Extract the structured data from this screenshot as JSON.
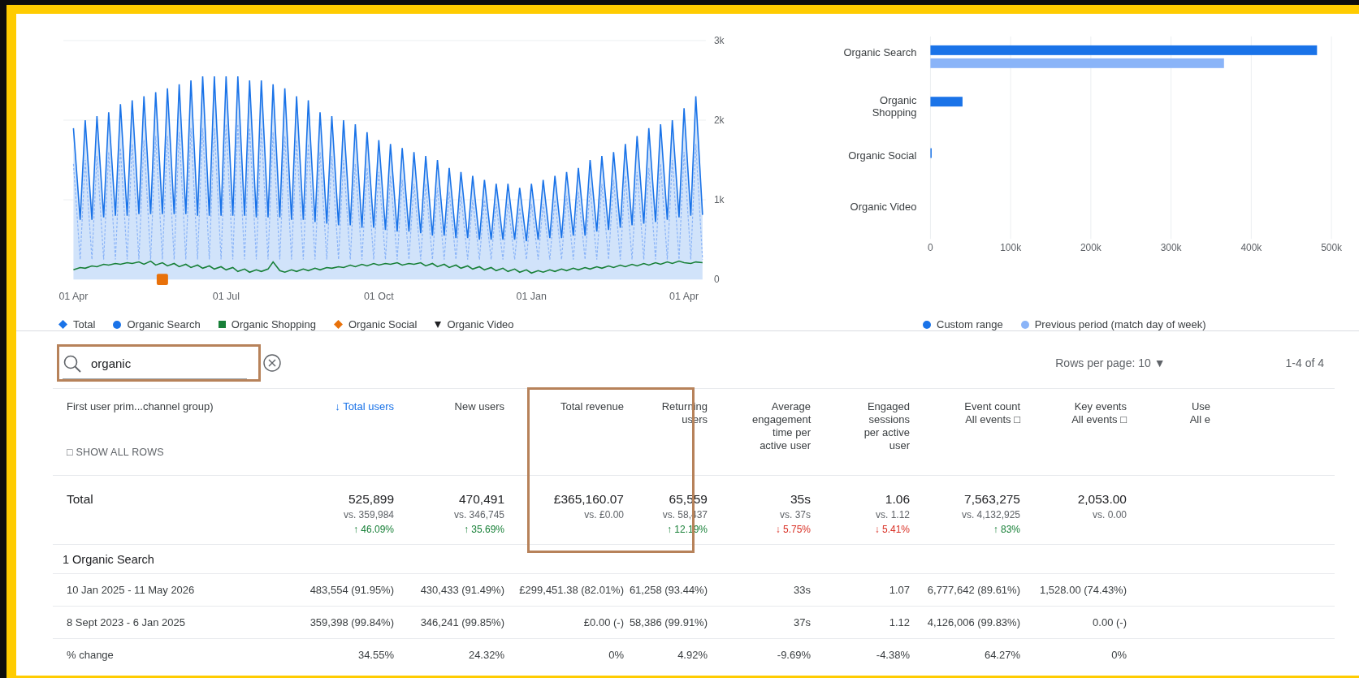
{
  "line_chart": {
    "chart_data": {
      "type": "line",
      "grid": true,
      "ylim": [
        0,
        3000
      ],
      "yticks": [
        {
          "value": 0,
          "label": "0"
        },
        {
          "value": 1000,
          "label": "1k"
        },
        {
          "value": 2000,
          "label": "2k"
        },
        {
          "value": 3000,
          "label": "3k"
        }
      ],
      "categories": [
        "01 Apr",
        null,
        null,
        null,
        null,
        null,
        null,
        null,
        null,
        null,
        null,
        null,
        null,
        null,
        null,
        null,
        null,
        null,
        null,
        null,
        null,
        null,
        null,
        null,
        null,
        null,
        "01 Jul",
        null,
        null,
        null,
        null,
        null,
        null,
        null,
        null,
        null,
        null,
        null,
        null,
        null,
        null,
        null,
        null,
        null,
        null,
        null,
        null,
        null,
        null,
        null,
        null,
        null,
        "01 Oct",
        null,
        null,
        null,
        null,
        null,
        null,
        null,
        null,
        null,
        null,
        null,
        null,
        null,
        null,
        null,
        null,
        null,
        null,
        null,
        null,
        null,
        null,
        null,
        null,
        null,
        "01 Jan",
        null,
        null,
        null,
        null,
        null,
        null,
        null,
        null,
        null,
        null,
        null,
        null,
        null,
        null,
        null,
        null,
        null,
        null,
        null,
        null,
        null,
        null,
        null,
        null,
        null,
        "01 Apr",
        null,
        null,
        null
      ],
      "series": [
        {
          "color": "#1a73e8",
          "type": "area",
          "values": [
            1900,
            750,
            2000,
            750,
            2050,
            780,
            2100,
            800,
            2200,
            800,
            2250,
            820,
            2300,
            820,
            2350,
            820,
            2400,
            820,
            2450,
            820,
            2500,
            800,
            2550,
            800,
            2550,
            800,
            2550,
            800,
            2550,
            800,
            2500,
            780,
            2500,
            780,
            2450,
            780,
            2400,
            750,
            2300,
            750,
            2250,
            720,
            2100,
            700,
            2050,
            680,
            2000,
            680,
            1950,
            650,
            1850,
            650,
            1750,
            620,
            1700,
            600,
            1650,
            600,
            1600,
            580,
            1550,
            550,
            1500,
            550,
            1400,
            520,
            1350,
            520,
            1300,
            500,
            1250,
            500,
            1200,
            500,
            1200,
            500,
            1150,
            480,
            1200,
            500,
            1250,
            520,
            1300,
            520,
            1350,
            550,
            1400,
            550,
            1500,
            600,
            1550,
            620,
            1600,
            650,
            1700,
            680,
            1800,
            700,
            1900,
            720,
            1950,
            750,
            2000,
            780,
            2150,
            800,
            2300,
            810
          ]
        },
        {
          "color": "#188038",
          "values": [
            120,
            150,
            140,
            170,
            160,
            190,
            180,
            200,
            190,
            210,
            200,
            220,
            190,
            230,
            180,
            210,
            170,
            200,
            160,
            190,
            150,
            180,
            140,
            170,
            130,
            160,
            120,
            150,
            100,
            130,
            90,
            120,
            100,
            130,
            220,
            110,
            90,
            120,
            100,
            130,
            110,
            140,
            120,
            150,
            140,
            160,
            150,
            180,
            160,
            190,
            170,
            200,
            180,
            200,
            190,
            210,
            180,
            200,
            190,
            210,
            170,
            200,
            160,
            190,
            150,
            180,
            140,
            170,
            130,
            160,
            120,
            150,
            110,
            140,
            100,
            130,
            90,
            120,
            80,
            110,
            90,
            120,
            100,
            130,
            110,
            140,
            120,
            150,
            130,
            160,
            140,
            170,
            150,
            180,
            160,
            190,
            170,
            200,
            180,
            210,
            190,
            220,
            200,
            230,
            210,
            200,
            220,
            210
          ]
        },
        {
          "color": "#8ab4f8",
          "line_style": "dashed",
          "values": [
            1450,
            250,
            1500,
            250,
            1550,
            250,
            1600,
            250,
            1650,
            250,
            1700,
            250,
            1750,
            250,
            1800,
            250,
            1800,
            250,
            1850,
            250,
            1900,
            250,
            1900,
            250,
            1900,
            250,
            1950,
            250,
            1950,
            250,
            1900,
            250,
            1900,
            250,
            1850,
            250,
            1800,
            250,
            1750,
            250,
            1700,
            250,
            1600,
            250,
            1550,
            250,
            1500,
            250,
            1450,
            250,
            1400,
            250,
            1350,
            250,
            1300,
            250,
            1250,
            250,
            1200,
            250,
            1200,
            250,
            1150,
            250,
            1100,
            250,
            1050,
            250,
            1000,
            250,
            1000,
            250,
            950,
            250,
            950,
            250,
            900,
            250,
            950,
            250,
            950,
            250,
            1000,
            250,
            1050,
            250,
            1100,
            250,
            1150,
            250,
            1200,
            250,
            1250,
            250,
            1300,
            250,
            1350,
            250,
            1400,
            250,
            1450,
            250,
            1500,
            250,
            1600,
            250,
            1700,
            250
          ]
        },
        {
          "color": "#e8710a",
          "marker": "square",
          "values": [
            null,
            null,
            null,
            null,
            null,
            null,
            null,
            null,
            null,
            null,
            null,
            null,
            null,
            null,
            null,
            0,
            null,
            null,
            null,
            null,
            null,
            null,
            null,
            null,
            null,
            null,
            null,
            null,
            null,
            null,
            null,
            null,
            null,
            null,
            null,
            null,
            null,
            null,
            null,
            null,
            null,
            null,
            null,
            null,
            null,
            null,
            null,
            null,
            null,
            null,
            null,
            null,
            null,
            null,
            null,
            null,
            null,
            null,
            null,
            null,
            null,
            null,
            null,
            null,
            null,
            null,
            null,
            null,
            null,
            null,
            null,
            null,
            null,
            null,
            null,
            null,
            null,
            null,
            null,
            null,
            null,
            null,
            null,
            null,
            null,
            null,
            null,
            null,
            null,
            null,
            null,
            null,
            null,
            null,
            null,
            null,
            null,
            null,
            null,
            null,
            null,
            null,
            null,
            null,
            null,
            null,
            null,
            null
          ]
        }
      ]
    },
    "legend": [
      {
        "label": "Total",
        "kind": "diamond",
        "color": "#1a73e8"
      },
      {
        "label": "Organic Search",
        "kind": "circle",
        "color": "#1a73e8"
      },
      {
        "label": "Organic Shopping",
        "kind": "square",
        "color": "#188038"
      },
      {
        "label": "Organic Social",
        "kind": "diamond",
        "color": "#e8710a"
      },
      {
        "label": "Organic Video",
        "kind": "triangle",
        "color": "#202124"
      }
    ]
  },
  "bar_chart": {
    "chart_data": {
      "type": "bar",
      "orientation": "horizontal",
      "grid": true,
      "categories": [
        "Organic Search",
        "Organic Shopping",
        "Organic Social",
        "Organic Video"
      ],
      "xlim": [
        0,
        500000
      ],
      "xticks": [
        {
          "value": 0,
          "label": "0"
        },
        {
          "value": 100000,
          "label": "100k"
        },
        {
          "value": 200000,
          "label": "200k"
        },
        {
          "value": 300000,
          "label": "300k"
        },
        {
          "value": 400000,
          "label": "400k"
        },
        {
          "value": 500000,
          "label": "500k"
        }
      ],
      "series": [
        {
          "name": "Custom range",
          "color": "#1a73e8",
          "values": [
            482000,
            40000,
            1000,
            0
          ]
        },
        {
          "name": "Previous period (match day of week)",
          "color": "#8ab4f8",
          "values": [
            366000,
            0,
            0,
            0
          ]
        }
      ]
    }
  },
  "search": {
    "value": "organic",
    "highlighted": true
  },
  "rows_per_page": "Rows per page: 10 ▼",
  "pagination": "1-4 of 4",
  "table": {
    "columns": [
      {
        "label": "First user prim...channel group)",
        "sorted": false,
        "highlighted": false
      },
      {
        "label": "↓ Total users",
        "sorted": true,
        "highlighted": false
      },
      {
        "label": "New users",
        "sorted": false,
        "highlighted": false
      },
      {
        "label": "Total revenue",
        "sorted": false,
        "highlighted": true
      },
      {
        "label": "Returning users",
        "sorted": false,
        "highlighted": true
      },
      {
        "label": "Average engagement time per active user",
        "sorted": false,
        "highlighted": false
      },
      {
        "label": "Engaged sessions per active user",
        "sorted": false,
        "highlighted": false
      },
      {
        "label": "Event count",
        "sub": "All events □",
        "sorted": false,
        "highlighted": false
      },
      {
        "label": "Key events",
        "sub": "All events □",
        "sorted": false,
        "highlighted": false
      },
      {
        "label": "Use",
        "sub": "All e",
        "sorted": false,
        "highlighted": false
      }
    ],
    "show_all_rows": "□ SHOW ALL ROWS",
    "total": {
      "label": "Total",
      "cells": [
        {
          "value": "525,899",
          "vs": "vs. 359,984",
          "change": "↑ 46.09%",
          "color": "#188038"
        },
        {
          "value": "470,491",
          "vs": "vs. 346,745",
          "change": "↑ 35.69%",
          "color": "#188038"
        },
        {
          "value": "£365,160.07",
          "vs": "vs. £0.00"
        },
        {
          "value": "65,559",
          "vs": "vs. 58,437",
          "change": "↑ 12.19%",
          "color": "#188038"
        },
        {
          "value": "35s",
          "vs": "vs. 37s",
          "change": "↓ 5.75%",
          "color": "#d93025"
        },
        {
          "value": "1.06",
          "vs": "vs. 1.12",
          "change": "↓ 5.41%",
          "color": "#d93025"
        },
        {
          "value": "7,563,275",
          "vs": "vs. 4,132,925",
          "change": "↑ 83%",
          "color": "#188038"
        },
        {
          "value": "2,053.00",
          "vs": "vs. 0.00"
        }
      ]
    },
    "group": "1 Organic Search",
    "rows": [
      [
        "10 Jan 2025 - 11 May 2026",
        "483,554 (91.95%)",
        "430,433 (91.49%)",
        "£299,451.38 (82.01%)",
        "61,258 (93.44%)",
        "33s",
        "1.07",
        "6,777,642 (89.61%)",
        "1,528.00 (74.43%)"
      ],
      [
        "8 Sept 2023 - 6 Jan 2025",
        "359,398 (99.84%)",
        "346,241 (99.85%)",
        "£0.00 (-)",
        "58,386 (99.91%)",
        "37s",
        "1.12",
        "4,126,006 (99.83%)",
        "0.00 (-)"
      ],
      [
        "% change",
        "34.55%",
        "24.32%",
        "0%",
        "4.92%",
        "-9.69%",
        "-4.38%",
        "64.27%",
        "0%"
      ]
    ]
  }
}
